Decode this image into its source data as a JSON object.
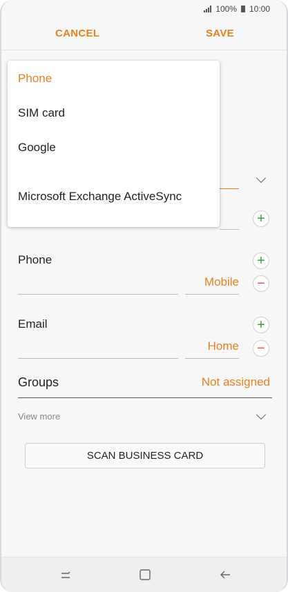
{
  "status": {
    "battery": "100%",
    "time": "10:00"
  },
  "header": {
    "cancel": "CANCEL",
    "save": "SAVE"
  },
  "dropdown": {
    "items": [
      "Phone",
      "SIM card",
      "Google",
      "Microsoft Exchange ActiveSync"
    ],
    "selected": "Phone"
  },
  "form": {
    "phone": {
      "label": "Phone",
      "type": "Mobile"
    },
    "email": {
      "label": "Email",
      "type": "Home"
    },
    "groups": {
      "label": "Groups",
      "value": "Not assigned"
    },
    "view_more": "View more",
    "scan_button": "SCAN BUSINESS CARD"
  },
  "colors": {
    "accent": "#e8801f",
    "add": "#2eaa3c",
    "remove": "#e24c4c"
  },
  "icons": [
    "signal-icon",
    "battery-icon",
    "chevron-down-icon",
    "add-circle-icon",
    "remove-circle-icon",
    "recent-apps-icon",
    "home-icon",
    "back-icon"
  ]
}
